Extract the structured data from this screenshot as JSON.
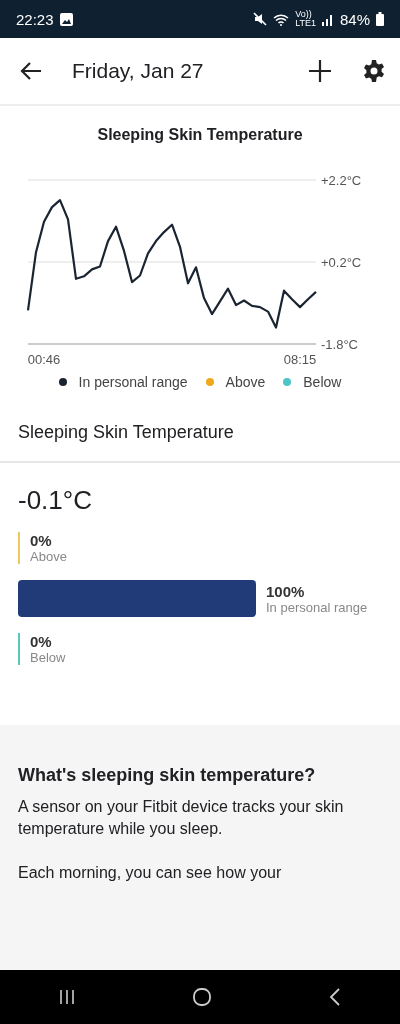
{
  "status_bar": {
    "time": "22:23",
    "volte": [
      "Vo))",
      "LTE1"
    ],
    "battery": "84%"
  },
  "app_bar": {
    "title": "Friday, Jan 27"
  },
  "chart_title": "Sleeping Skin Temperature",
  "chart_data": {
    "type": "line",
    "categories": [
      null,
      null,
      "00:46",
      null,
      null,
      null,
      null,
      null,
      null,
      null,
      null,
      null,
      null,
      null,
      null,
      null,
      null,
      null,
      null,
      null,
      null,
      null,
      null,
      null,
      null,
      null,
      null,
      null,
      null,
      null,
      null,
      null,
      null,
      null,
      "08:15",
      null,
      null
    ],
    "series": [
      {
        "name": "In personal range",
        "color": "#1b2532",
        "values": [
          -0.98,
          0.44,
          1.18,
          1.54,
          1.71,
          1.24,
          -0.21,
          -0.15,
          0.02,
          0.09,
          0.71,
          1.06,
          0.47,
          -0.29,
          -0.13,
          0.41,
          0.71,
          0.93,
          1.11,
          0.57,
          -0.32,
          0.07,
          -0.68,
          -1.07,
          -0.76,
          -0.45,
          -0.85,
          -0.74,
          -0.87,
          -0.9,
          -1.01,
          -1.4,
          -0.5,
          -0.71,
          -0.9,
          -0.71,
          -0.53
        ]
      }
    ],
    "ylim": [
      -1.8,
      2.2
    ],
    "yticks": [
      {
        "value": 2.2,
        "label": "+2.2°C"
      },
      {
        "value": 0.2,
        "label": "+0.2°C"
      },
      {
        "value": -1.8,
        "label": "-1.8°C"
      }
    ]
  },
  "legend": [
    {
      "label": "Above",
      "color": "#f0a81c"
    },
    {
      "label": "Below",
      "color": "#4cc4c8"
    }
  ],
  "section_title": "Sleeping Skin Temperature",
  "reading": "-0.1°C",
  "breakdown": [
    {
      "kind": "line",
      "color": "#f0c860",
      "value": "0%",
      "label": "Above"
    },
    {
      "kind": "bar",
      "color": "#213a78",
      "value": "100%",
      "label": "In personal range"
    },
    {
      "kind": "line",
      "color": "#5cc6c0",
      "value": "0%",
      "label": "Below"
    }
  ],
  "info": {
    "heading": "What's sleeping skin temperature?",
    "paragraphs": [
      "A sensor on your Fitbit device tracks your skin temperature while you sleep.",
      "Each morning, you can see how your"
    ]
  }
}
